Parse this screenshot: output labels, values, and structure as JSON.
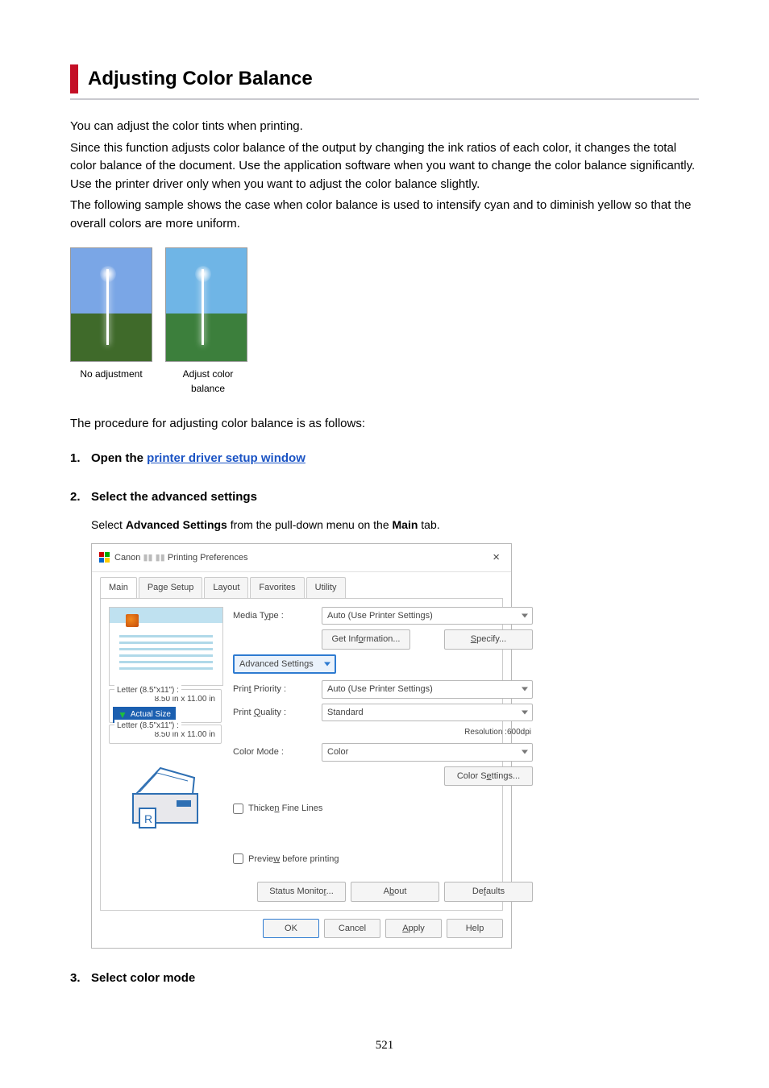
{
  "title": "Adjusting Color Balance",
  "intro": {
    "p1": "You can adjust the color tints when printing.",
    "p2": "Since this function adjusts color balance of the output by changing the ink ratios of each color, it changes the total color balance of the document. Use the application software when you want to change the color balance significantly. Use the printer driver only when you want to adjust the color balance slightly.",
    "p3": "The following sample shows the case when color balance is used to intensify cyan and to diminish yellow so that the overall colors are more uniform."
  },
  "captions": {
    "no_adjust": "No adjustment",
    "adjust": "Adjust color balance"
  },
  "proc_intro": "The procedure for adjusting color balance is as follows:",
  "steps": {
    "s1": {
      "num": "1.",
      "title_prefix": "Open the ",
      "link": "printer driver setup window"
    },
    "s2": {
      "num": "2.",
      "title": "Select the advanced settings",
      "desc_pre": "Select ",
      "desc_bold1": "Advanced Settings",
      "desc_mid": " from the pull-down menu on the ",
      "desc_bold2": "Main",
      "desc_post": " tab."
    },
    "s3": {
      "num": "3.",
      "title": "Select color mode"
    }
  },
  "dialog": {
    "window_title_prefix": "Canon ",
    "window_title_suffix": " Printing Preferences",
    "close": "×",
    "tabs": {
      "main": "Main",
      "page_setup": "Page Setup",
      "layout": "Layout",
      "favorites": "Favorites",
      "utility": "Utility"
    },
    "left": {
      "size1_label": "Letter (8.5\"x11\") :",
      "size1_dim": "8.50 in x 11.00 in",
      "actual": "Actual Size",
      "size2_label": "Letter (8.5\"x11\") :",
      "size2_dim": "8.50 in x 11.00 in"
    },
    "right": {
      "media_type_label": "Media Type :",
      "media_type_value": "Auto (Use Printer Settings)",
      "get_info_btn": "Get Information...",
      "specify_btn": "Specify...",
      "advanced_settings": "Advanced Settings",
      "print_priority_label": "Print Priority :",
      "print_priority_value": "Auto (Use Printer Settings)",
      "print_quality_label": "Print Quality :",
      "print_quality_value": "Standard",
      "resolution": "Resolution :600dpi",
      "color_mode_label": "Color Mode :",
      "color_mode_value": "Color",
      "color_settings_btn": "Color Settings...",
      "thicken": "Thicken Fine Lines",
      "preview": "Preview before printing",
      "status_btn": "Status Monitor...",
      "about_btn": "About",
      "defaults_btn": "Defaults"
    },
    "footer": {
      "ok": "OK",
      "cancel": "Cancel",
      "apply": "Apply",
      "help": "Help"
    }
  },
  "page_num": "521"
}
